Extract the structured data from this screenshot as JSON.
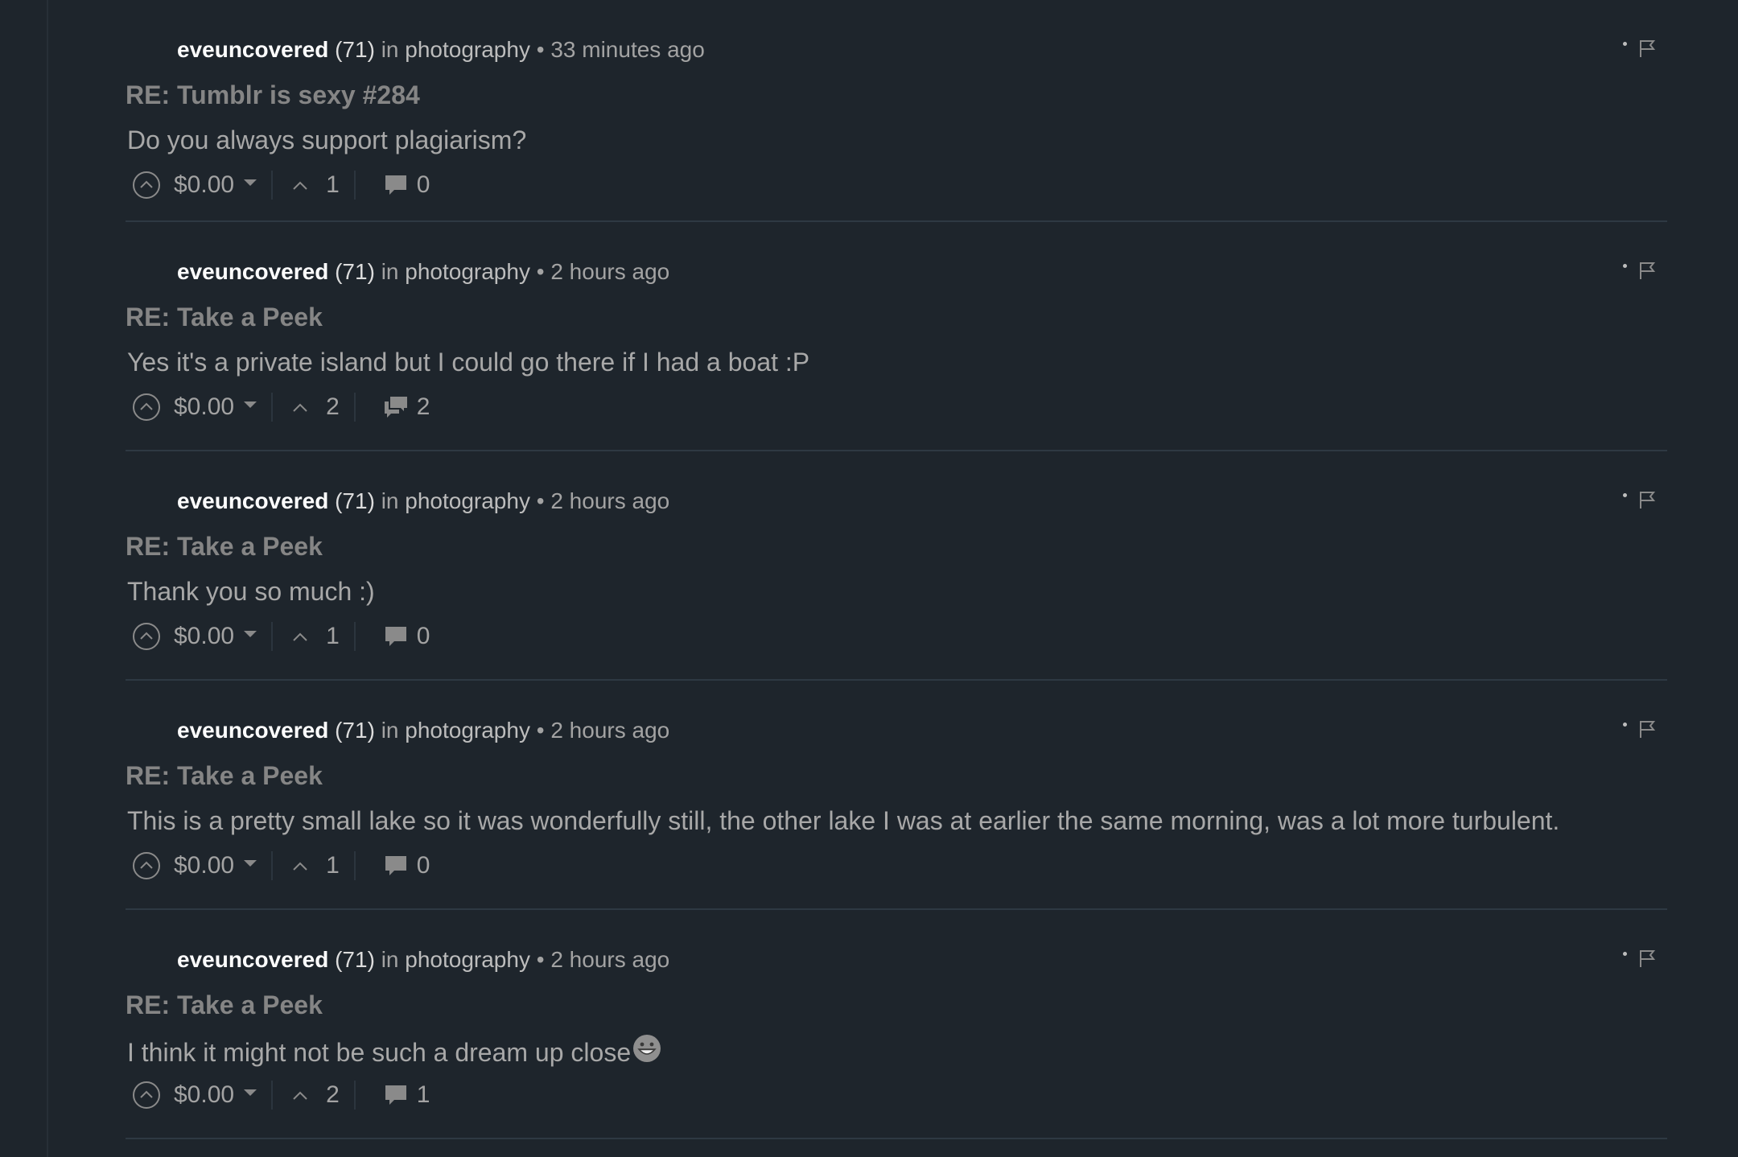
{
  "colors": {
    "background": "#1e252c",
    "divider": "#2e3943",
    "author": "#ffffff",
    "title": "#858585",
    "body": "#a8a8a8",
    "meta": "#a3a3a3"
  },
  "icons": {
    "upvote": "circle-chevron-up-icon",
    "payout_dropdown": "caret-down-icon",
    "votes": "chevron-up-icon",
    "replies_single": "comment-bubble-icon",
    "replies_multiple": "comments-bubbles-icon",
    "more": "dot-icon",
    "flag": "flag-icon"
  },
  "comments": [
    {
      "author": "eveuncovered",
      "reputation": "(71)",
      "in_label": "in",
      "category": "photography",
      "separator": "•",
      "time": "33 minutes ago",
      "title": "RE: Tumblr is sexy #284",
      "body": "Do you always support plagiarism?",
      "payout": "$0.00",
      "votes": "1",
      "replies": "0",
      "replies_icon": "comment-bubble-icon"
    },
    {
      "author": "eveuncovered",
      "reputation": "(71)",
      "in_label": "in",
      "category": "photography",
      "separator": "•",
      "time": "2 hours ago",
      "title": "RE: Take a Peek",
      "body": "Yes it's a private island but I could go there if I had a boat :P",
      "payout": "$0.00",
      "votes": "2",
      "replies": "2",
      "replies_icon": "comments-bubbles-icon"
    },
    {
      "author": "eveuncovered",
      "reputation": "(71)",
      "in_label": "in",
      "category": "photography",
      "separator": "•",
      "time": "2 hours ago",
      "title": "RE: Take a Peek",
      "body": "Thank you so much :)",
      "payout": "$0.00",
      "votes": "1",
      "replies": "0",
      "replies_icon": "comment-bubble-icon"
    },
    {
      "author": "eveuncovered",
      "reputation": "(71)",
      "in_label": "in",
      "category": "photography",
      "separator": "•",
      "time": "2 hours ago",
      "title": "RE: Take a Peek",
      "body": "This is a pretty small lake so it was wonderfully still, the other lake I was at earlier the same morning, was a lot more turbulent.",
      "payout": "$0.00",
      "votes": "1",
      "replies": "0",
      "replies_icon": "comment-bubble-icon"
    },
    {
      "author": "eveuncovered",
      "reputation": "(71)",
      "in_label": "in",
      "category": "photography",
      "separator": "•",
      "time": "2 hours ago",
      "title": "RE: Take a Peek",
      "body": "I think it might not be such a dream up close",
      "body_emoji": "grinning-face-emoji",
      "payout": "$0.00",
      "votes": "2",
      "replies": "1",
      "replies_icon": "comment-bubble-icon"
    }
  ]
}
